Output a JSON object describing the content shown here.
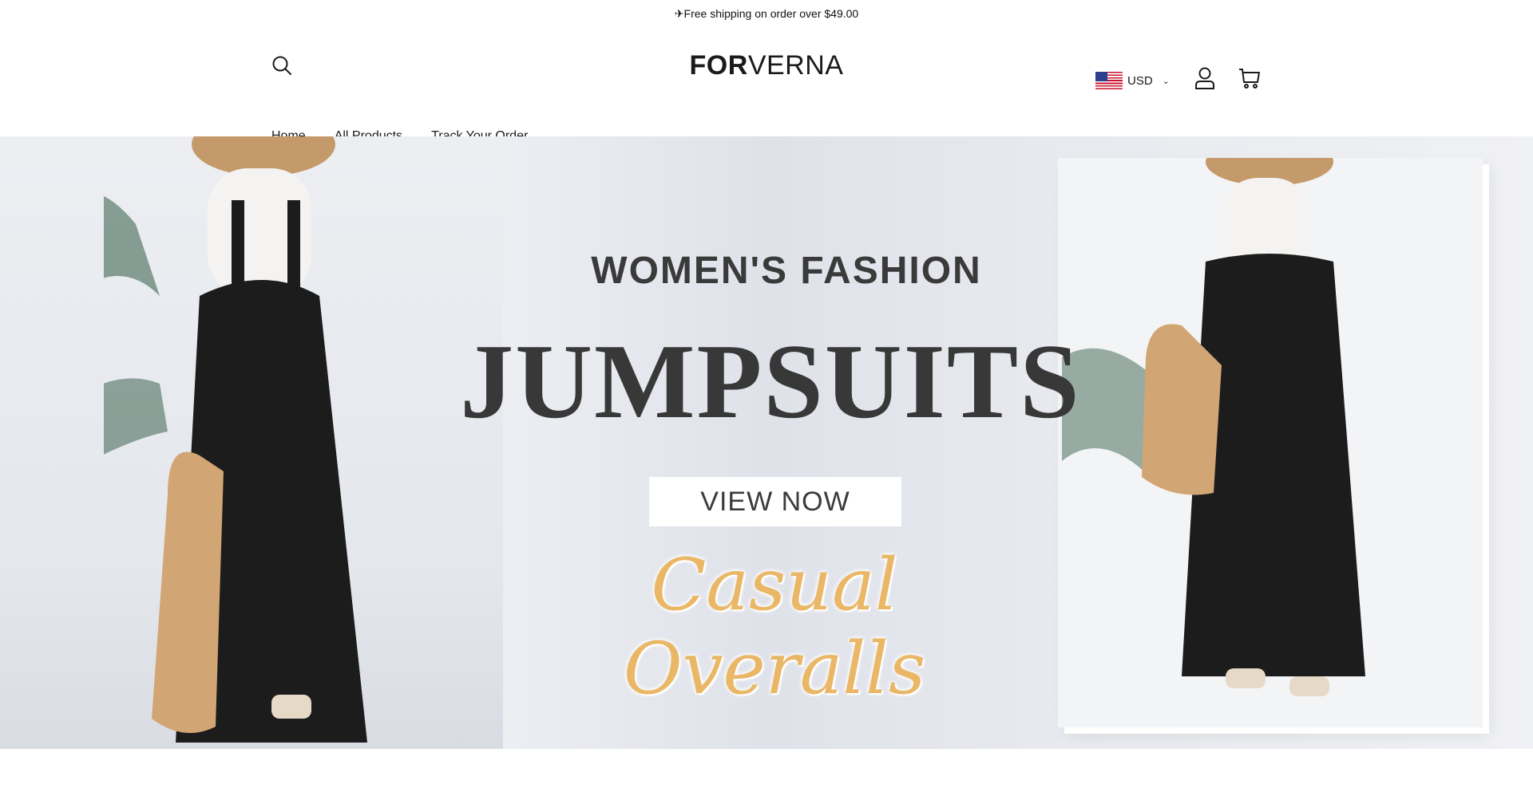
{
  "announcement": {
    "text": "✈Free shipping on order over $49.00"
  },
  "header": {
    "logo_bold": "FOR",
    "logo_light": "VERNA",
    "currency": "USD",
    "icons": {
      "search": "search-icon",
      "account": "user-icon",
      "cart": "cart-icon",
      "flag": "us-flag-icon",
      "chevron": "chevron-down-icon"
    }
  },
  "nav": {
    "items": [
      {
        "label": "Home"
      },
      {
        "label": "All Products"
      },
      {
        "label": "Track Your Order"
      }
    ]
  },
  "hero": {
    "subtitle": "WOMEN'S FASHION",
    "title": "JUMPSUITS",
    "cta": "VIEW NOW",
    "script": "Casual Overalls"
  },
  "colors": {
    "script_gold": "#e9b766",
    "title_dark": "#383838"
  }
}
